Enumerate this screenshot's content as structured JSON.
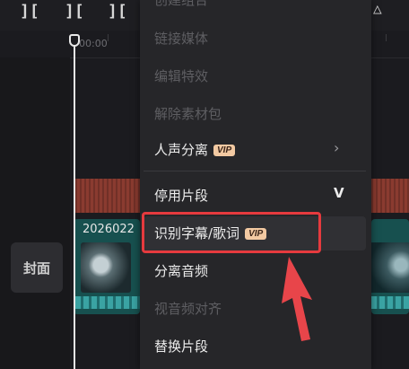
{
  "ruler": {
    "time": "00:00"
  },
  "cover": {
    "label": "封面"
  },
  "video_clip": {
    "label": "2026022"
  },
  "context_menu": {
    "items": [
      {
        "label": "创建组合",
        "enabled": false
      },
      {
        "label": "链接媒体",
        "enabled": false
      },
      {
        "label": "编辑特效",
        "enabled": false
      },
      {
        "label": "解除素材包",
        "enabled": false
      },
      {
        "label": "人声分离",
        "enabled": true,
        "badge": "VIP",
        "submenu": true
      },
      {
        "label": "停用片段",
        "enabled": true,
        "shortcut": "V"
      },
      {
        "label": "识别字幕/歌词",
        "enabled": true,
        "badge": "VIP",
        "highlighted": true
      },
      {
        "label": "分离音频",
        "enabled": true
      },
      {
        "label": "视音频对齐",
        "enabled": false
      },
      {
        "label": "替换片段",
        "enabled": true
      }
    ]
  },
  "colors": {
    "highlight": "#e63a3e",
    "vip_badge": "#f2c9a2",
    "audio_track": "#8a3b30",
    "video_track": "#17504f"
  }
}
